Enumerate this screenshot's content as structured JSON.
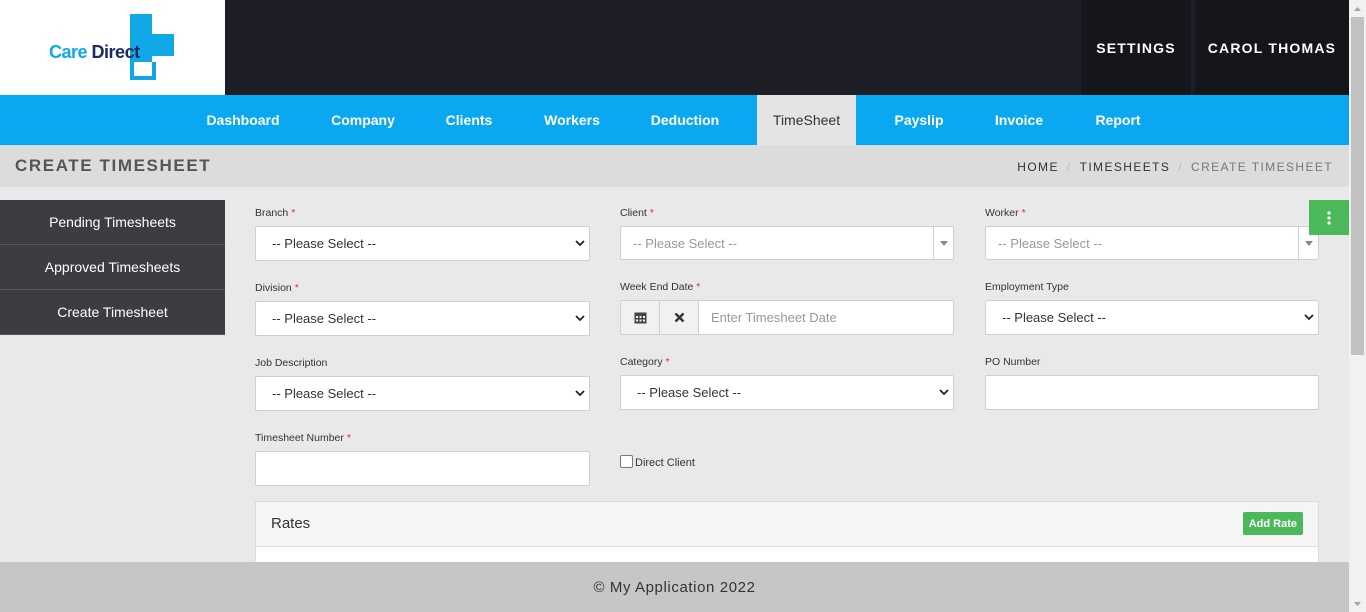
{
  "brand": {
    "name_part1": "Care",
    "name_part2": "Direct",
    "logo_color": "#0fa7e6"
  },
  "top_nav": {
    "settings_label": "SETTINGS",
    "user_label": "CAROL THOMAS"
  },
  "main_nav": {
    "items": [
      {
        "label": "Dashboard"
      },
      {
        "label": "Company"
      },
      {
        "label": "Clients"
      },
      {
        "label": "Workers"
      },
      {
        "label": "Deduction"
      },
      {
        "label": "TimeSheet"
      },
      {
        "label": "Payslip"
      },
      {
        "label": "Invoice"
      },
      {
        "label": "Report"
      }
    ],
    "active": "TimeSheet",
    "color": "#0aa8f0"
  },
  "page": {
    "title": "CREATE TIMESHEET",
    "breadcrumb": [
      "HOME",
      "TIMESHEETS",
      "CREATE TIMESHEET"
    ]
  },
  "side_menu": {
    "items": [
      {
        "label": "Pending Timesheets"
      },
      {
        "label": "Approved Timesheets"
      },
      {
        "label": "Create Timesheet"
      }
    ]
  },
  "form": {
    "branch": {
      "label": "Branch",
      "value": "-- Please Select --"
    },
    "client": {
      "label": "Client",
      "placeholder": "-- Please Select --"
    },
    "worker": {
      "label": "Worker",
      "placeholder": "-- Please Select --"
    },
    "division": {
      "label": "Division",
      "value": "-- Please Select --"
    },
    "week_end_date": {
      "label": "Week End Date",
      "placeholder": "Enter Timesheet Date"
    },
    "employment_type": {
      "label": "Employment Type",
      "value": "-- Please Select --"
    },
    "job_description": {
      "label": "Job Description",
      "value": "-- Please Select --"
    },
    "category": {
      "label": "Category",
      "value": "-- Please Select --"
    },
    "po_number": {
      "label": "PO Number",
      "value": ""
    },
    "timesheet_number": {
      "label": "Timesheet Number",
      "value": ""
    },
    "direct_client": {
      "label": "Direct Client",
      "checked": false
    },
    "required_mark": "*"
  },
  "rates": {
    "title": "Rates",
    "add_button": "Add Rate"
  },
  "footer": {
    "text": "© My Application 2022"
  },
  "colors": {
    "accent_green": "#4cb85c",
    "header_dark": "#1e1f26",
    "required_red": "#e0301e"
  }
}
